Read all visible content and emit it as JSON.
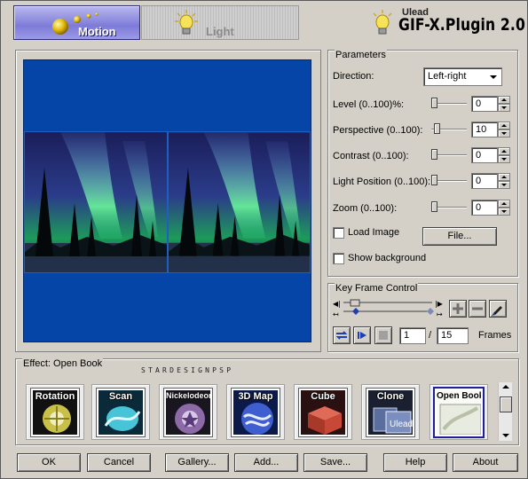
{
  "tabs": {
    "motion": "Motion",
    "light": "Light"
  },
  "brand": {
    "company": "Ulead",
    "product": "GIF-X.Plugin 2.0"
  },
  "parameters": {
    "title": "Parameters",
    "direction_label": "Direction:",
    "direction_value": "Left-right",
    "rows": [
      {
        "label": "Level (0..100)%:",
        "value": "0",
        "level": 0
      },
      {
        "label": "Perspective (0..100):",
        "value": "10",
        "level": 0.1
      },
      {
        "label": "Contrast (0..100):",
        "value": "0",
        "level": 0
      },
      {
        "label": "Light Position (0..100):",
        "value": "0",
        "level": 0
      },
      {
        "label": "Zoom (0..100):",
        "value": "0",
        "level": 0
      }
    ],
    "load_image": "Load Image",
    "file_button": "File...",
    "show_background": "Show background"
  },
  "keyframe": {
    "title": "Key Frame Control",
    "current_frame": "1",
    "separator": "/",
    "total_frames": "15",
    "frames_label": "Frames"
  },
  "effects": {
    "title": "Effect: Open Book",
    "watermark": "STARDESIGNPSP",
    "items": [
      {
        "name": "Rotation",
        "color": "#c9c04a"
      },
      {
        "name": "Scan",
        "color": "#48c4d8"
      },
      {
        "name": "Nickelodeon",
        "color": "#8c6aa8"
      },
      {
        "name": "3D Map",
        "color": "#3f5fd0"
      },
      {
        "name": "Cube",
        "color": "#c84838"
      },
      {
        "name": "Clone",
        "color": "#5a6ea0"
      },
      {
        "name": "Open Book",
        "color": "#f2f2ee"
      }
    ]
  },
  "buttons": {
    "ok": "OK",
    "cancel": "Cancel",
    "gallery": "Gallery...",
    "add": "Add...",
    "save": "Save...",
    "help": "Help",
    "about": "About"
  },
  "colors": {
    "preview_background": "#0645a8",
    "motion_tab": "#7d7bd8",
    "dialog": "#d4d0c8"
  }
}
